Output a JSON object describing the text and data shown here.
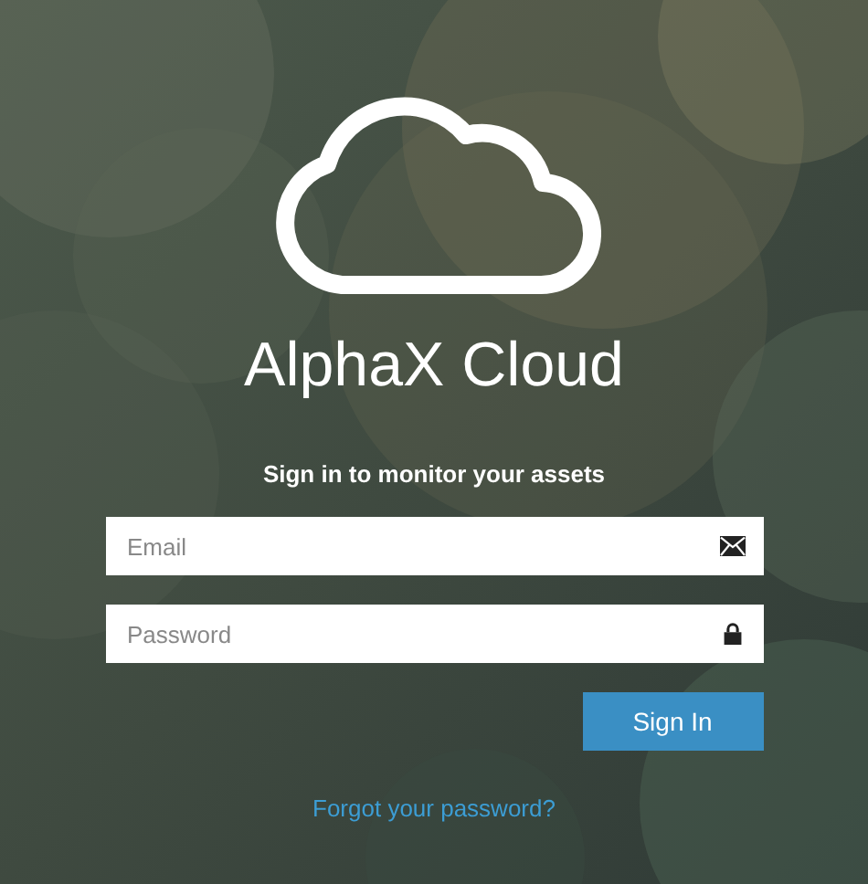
{
  "logo": {
    "title": "AlphaX Cloud"
  },
  "subtitle": "Sign in to monitor your assets",
  "form": {
    "email": {
      "placeholder": "Email"
    },
    "password": {
      "placeholder": "Password"
    },
    "submit": "Sign In"
  },
  "forgot_link": "Forgot your password?"
}
